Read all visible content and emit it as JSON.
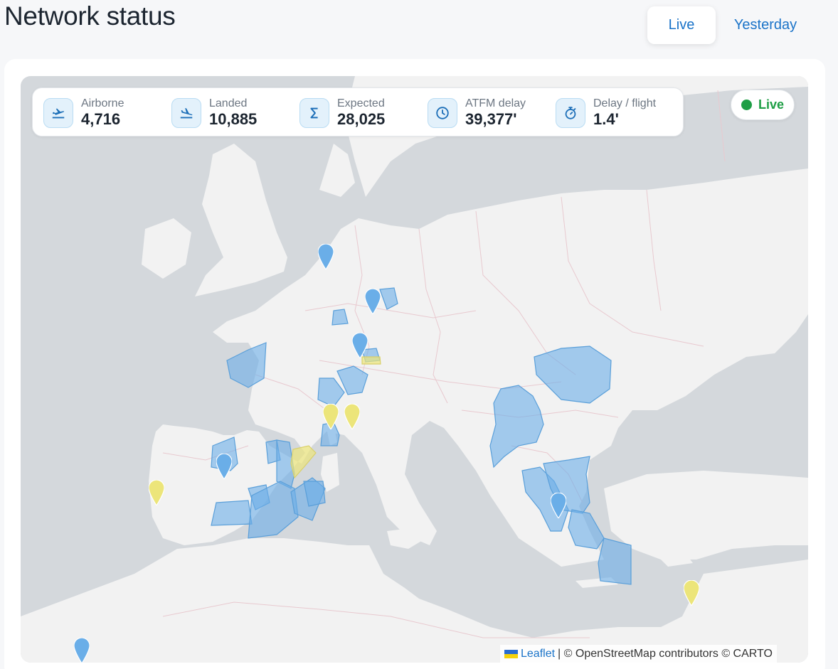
{
  "page": {
    "title": "Network status"
  },
  "tabs": [
    {
      "label": "Live",
      "active": true
    },
    {
      "label": "Yesterday",
      "active": false
    }
  ],
  "stats": [
    {
      "icon": "takeoff-icon",
      "label": "Airborne",
      "value": "4,716"
    },
    {
      "icon": "landing-icon",
      "label": "Landed",
      "value": "10,885"
    },
    {
      "icon": "sigma-icon",
      "label": "Expected",
      "value": "28,025"
    },
    {
      "icon": "clock-icon",
      "label": "ATFM delay",
      "value": "39,377'"
    },
    {
      "icon": "stopwatch-icon",
      "label": "Delay / flight",
      "value": "1.4'"
    }
  ],
  "live_indicator": {
    "label": "Live",
    "color": "#1e9e45"
  },
  "attribution": {
    "leaflet": "Leaflet",
    "rest": "| © OpenStreetMap contributors © CARTO"
  },
  "map": {
    "colors": {
      "water": "#d4d8dc",
      "land": "#f2f2f2",
      "border": "#e8c9cf",
      "region_blue": "#6aaee8",
      "region_yellow": "#ece57a"
    },
    "markers": [
      {
        "type": "blue"
      },
      {
        "type": "blue"
      },
      {
        "type": "blue"
      },
      {
        "type": "blue"
      },
      {
        "type": "blue"
      },
      {
        "type": "blue"
      },
      {
        "type": "yellow"
      },
      {
        "type": "yellow"
      },
      {
        "type": "yellow"
      },
      {
        "type": "yellow"
      }
    ]
  }
}
